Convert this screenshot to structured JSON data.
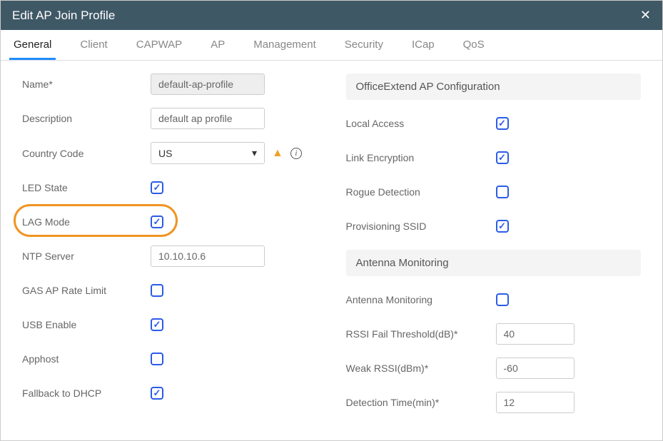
{
  "header": {
    "title": "Edit AP Join Profile"
  },
  "tabs": [
    {
      "label": "General",
      "active": true
    },
    {
      "label": "Client"
    },
    {
      "label": "CAPWAP"
    },
    {
      "label": "AP"
    },
    {
      "label": "Management"
    },
    {
      "label": "Security"
    },
    {
      "label": "ICap"
    },
    {
      "label": "QoS"
    }
  ],
  "left": {
    "name_label": "Name*",
    "name_value": "default-ap-profile",
    "description_label": "Description",
    "description_value": "default ap profile",
    "country_label": "Country Code",
    "country_value": "US",
    "led_label": "LED State",
    "led_checked": true,
    "lag_label": "LAG Mode",
    "lag_checked": true,
    "ntp_label": "NTP Server",
    "ntp_value": "10.10.10.6",
    "gas_label": "GAS AP Rate Limit",
    "gas_checked": false,
    "usb_label": "USB Enable",
    "usb_checked": true,
    "apphost_label": "Apphost",
    "apphost_checked": false,
    "fallback_label": "Fallback to DHCP",
    "fallback_checked": true
  },
  "right": {
    "section1": "OfficeExtend AP Configuration",
    "local_access_label": "Local Access",
    "local_access_checked": true,
    "link_enc_label": "Link Encryption",
    "link_enc_checked": true,
    "rogue_label": "Rogue Detection",
    "rogue_checked": false,
    "prov_label": "Provisioning SSID",
    "prov_checked": true,
    "section2": "Antenna Monitoring",
    "antmon_label": "Antenna Monitoring",
    "antmon_checked": false,
    "rssi_fail_label": "RSSI Fail Threshold(dB)*",
    "rssi_fail_value": "40",
    "weak_rssi_label": "Weak RSSI(dBm)*",
    "weak_rssi_value": "-60",
    "det_time_label": "Detection Time(min)*",
    "det_time_value": "12"
  }
}
